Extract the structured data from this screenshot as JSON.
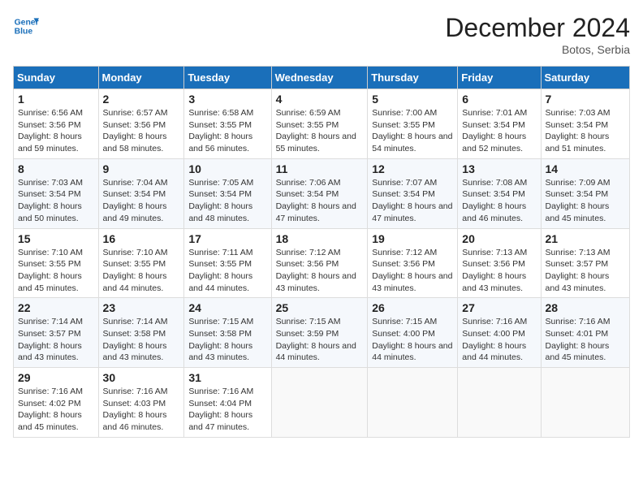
{
  "header": {
    "logo_line1": "General",
    "logo_line2": "Blue",
    "month_year": "December 2024",
    "location": "Botos, Serbia"
  },
  "weekdays": [
    "Sunday",
    "Monday",
    "Tuesday",
    "Wednesday",
    "Thursday",
    "Friday",
    "Saturday"
  ],
  "weeks": [
    [
      {
        "day": "1",
        "sunrise": "Sunrise: 6:56 AM",
        "sunset": "Sunset: 3:56 PM",
        "daylight": "Daylight: 8 hours and 59 minutes."
      },
      {
        "day": "2",
        "sunrise": "Sunrise: 6:57 AM",
        "sunset": "Sunset: 3:56 PM",
        "daylight": "Daylight: 8 hours and 58 minutes."
      },
      {
        "day": "3",
        "sunrise": "Sunrise: 6:58 AM",
        "sunset": "Sunset: 3:55 PM",
        "daylight": "Daylight: 8 hours and 56 minutes."
      },
      {
        "day": "4",
        "sunrise": "Sunrise: 6:59 AM",
        "sunset": "Sunset: 3:55 PM",
        "daylight": "Daylight: 8 hours and 55 minutes."
      },
      {
        "day": "5",
        "sunrise": "Sunrise: 7:00 AM",
        "sunset": "Sunset: 3:55 PM",
        "daylight": "Daylight: 8 hours and 54 minutes."
      },
      {
        "day": "6",
        "sunrise": "Sunrise: 7:01 AM",
        "sunset": "Sunset: 3:54 PM",
        "daylight": "Daylight: 8 hours and 52 minutes."
      },
      {
        "day": "7",
        "sunrise": "Sunrise: 7:03 AM",
        "sunset": "Sunset: 3:54 PM",
        "daylight": "Daylight: 8 hours and 51 minutes."
      }
    ],
    [
      {
        "day": "8",
        "sunrise": "Sunrise: 7:03 AM",
        "sunset": "Sunset: 3:54 PM",
        "daylight": "Daylight: 8 hours and 50 minutes."
      },
      {
        "day": "9",
        "sunrise": "Sunrise: 7:04 AM",
        "sunset": "Sunset: 3:54 PM",
        "daylight": "Daylight: 8 hours and 49 minutes."
      },
      {
        "day": "10",
        "sunrise": "Sunrise: 7:05 AM",
        "sunset": "Sunset: 3:54 PM",
        "daylight": "Daylight: 8 hours and 48 minutes."
      },
      {
        "day": "11",
        "sunrise": "Sunrise: 7:06 AM",
        "sunset": "Sunset: 3:54 PM",
        "daylight": "Daylight: 8 hours and 47 minutes."
      },
      {
        "day": "12",
        "sunrise": "Sunrise: 7:07 AM",
        "sunset": "Sunset: 3:54 PM",
        "daylight": "Daylight: 8 hours and 47 minutes."
      },
      {
        "day": "13",
        "sunrise": "Sunrise: 7:08 AM",
        "sunset": "Sunset: 3:54 PM",
        "daylight": "Daylight: 8 hours and 46 minutes."
      },
      {
        "day": "14",
        "sunrise": "Sunrise: 7:09 AM",
        "sunset": "Sunset: 3:54 PM",
        "daylight": "Daylight: 8 hours and 45 minutes."
      }
    ],
    [
      {
        "day": "15",
        "sunrise": "Sunrise: 7:10 AM",
        "sunset": "Sunset: 3:55 PM",
        "daylight": "Daylight: 8 hours and 45 minutes."
      },
      {
        "day": "16",
        "sunrise": "Sunrise: 7:10 AM",
        "sunset": "Sunset: 3:55 PM",
        "daylight": "Daylight: 8 hours and 44 minutes."
      },
      {
        "day": "17",
        "sunrise": "Sunrise: 7:11 AM",
        "sunset": "Sunset: 3:55 PM",
        "daylight": "Daylight: 8 hours and 44 minutes."
      },
      {
        "day": "18",
        "sunrise": "Sunrise: 7:12 AM",
        "sunset": "Sunset: 3:56 PM",
        "daylight": "Daylight: 8 hours and 43 minutes."
      },
      {
        "day": "19",
        "sunrise": "Sunrise: 7:12 AM",
        "sunset": "Sunset: 3:56 PM",
        "daylight": "Daylight: 8 hours and 43 minutes."
      },
      {
        "day": "20",
        "sunrise": "Sunrise: 7:13 AM",
        "sunset": "Sunset: 3:56 PM",
        "daylight": "Daylight: 8 hours and 43 minutes."
      },
      {
        "day": "21",
        "sunrise": "Sunrise: 7:13 AM",
        "sunset": "Sunset: 3:57 PM",
        "daylight": "Daylight: 8 hours and 43 minutes."
      }
    ],
    [
      {
        "day": "22",
        "sunrise": "Sunrise: 7:14 AM",
        "sunset": "Sunset: 3:57 PM",
        "daylight": "Daylight: 8 hours and 43 minutes."
      },
      {
        "day": "23",
        "sunrise": "Sunrise: 7:14 AM",
        "sunset": "Sunset: 3:58 PM",
        "daylight": "Daylight: 8 hours and 43 minutes."
      },
      {
        "day": "24",
        "sunrise": "Sunrise: 7:15 AM",
        "sunset": "Sunset: 3:58 PM",
        "daylight": "Daylight: 8 hours and 43 minutes."
      },
      {
        "day": "25",
        "sunrise": "Sunrise: 7:15 AM",
        "sunset": "Sunset: 3:59 PM",
        "daylight": "Daylight: 8 hours and 44 minutes."
      },
      {
        "day": "26",
        "sunrise": "Sunrise: 7:15 AM",
        "sunset": "Sunset: 4:00 PM",
        "daylight": "Daylight: 8 hours and 44 minutes."
      },
      {
        "day": "27",
        "sunrise": "Sunrise: 7:16 AM",
        "sunset": "Sunset: 4:00 PM",
        "daylight": "Daylight: 8 hours and 44 minutes."
      },
      {
        "day": "28",
        "sunrise": "Sunrise: 7:16 AM",
        "sunset": "Sunset: 4:01 PM",
        "daylight": "Daylight: 8 hours and 45 minutes."
      }
    ],
    [
      {
        "day": "29",
        "sunrise": "Sunrise: 7:16 AM",
        "sunset": "Sunset: 4:02 PM",
        "daylight": "Daylight: 8 hours and 45 minutes."
      },
      {
        "day": "30",
        "sunrise": "Sunrise: 7:16 AM",
        "sunset": "Sunset: 4:03 PM",
        "daylight": "Daylight: 8 hours and 46 minutes."
      },
      {
        "day": "31",
        "sunrise": "Sunrise: 7:16 AM",
        "sunset": "Sunset: 4:04 PM",
        "daylight": "Daylight: 8 hours and 47 minutes."
      },
      null,
      null,
      null,
      null
    ]
  ]
}
